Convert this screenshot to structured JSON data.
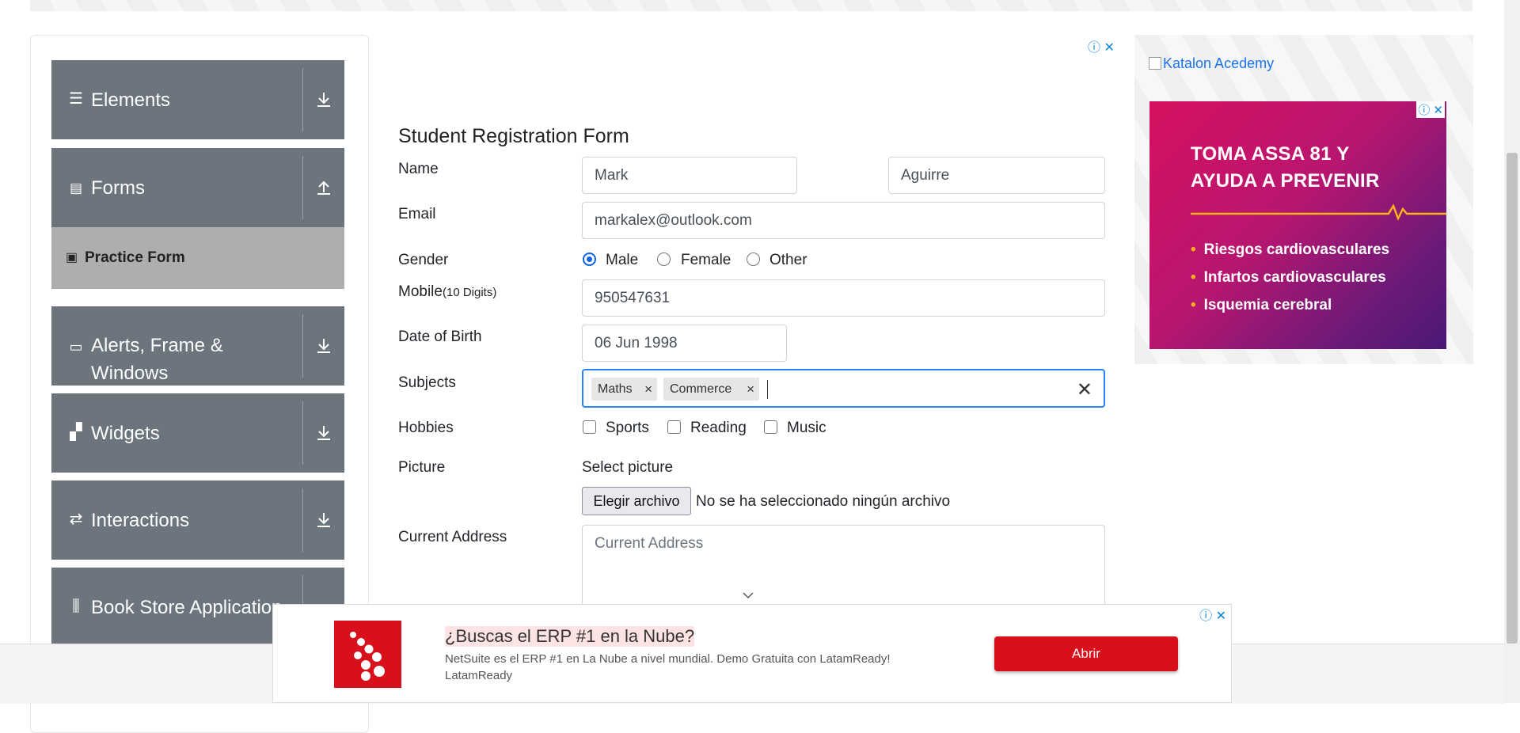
{
  "sidebar": {
    "groups": [
      {
        "label": "Elements",
        "icon": "hamburger-icon"
      },
      {
        "label": "Forms",
        "icon": "document-icon"
      },
      {
        "label": "Alerts, Frame &",
        "label2": "Windows",
        "icon": "window-icon"
      },
      {
        "label": "Widgets",
        "icon": "widgets-icon"
      },
      {
        "label": "Interactions",
        "icon": "interactions-icon"
      },
      {
        "label": "Book Store Application",
        "icon": "books-icon"
      }
    ],
    "active_item": "Practice Form"
  },
  "form": {
    "title": "Student Registration Form",
    "name_label": "Name",
    "first_name": "Mark",
    "last_name": "Aguirre",
    "email_label": "Email",
    "email": "markalex@outlook.com",
    "gender_label": "Gender",
    "gender_options": [
      "Male",
      "Female",
      "Other"
    ],
    "gender_selected": "Male",
    "mobile_label": "Mobile",
    "mobile_hint": "(10 Digits)",
    "mobile": "950547631",
    "dob_label": "Date of Birth",
    "dob": "06 Jun 1998",
    "subjects_label": "Subjects",
    "subjects": [
      "Maths",
      "Commerce"
    ],
    "hobbies_label": "Hobbies",
    "hobbies": [
      "Sports",
      "Reading",
      "Music"
    ],
    "picture_label": "Picture",
    "select_picture": "Select picture",
    "file_button": "Elegir archivo",
    "file_status": "No se ha seleccionado ningún archivo",
    "address_label": "Current Address",
    "address_placeholder": "Current Address"
  },
  "right_ad": {
    "image_alt": "Katalon Acedemy",
    "headline_1": "TOMA ASSA 81 Y",
    "headline_2": "AYUDA A PREVENIR",
    "items": [
      "Riesgos cardiovasculares",
      "Infartos cardiovasculares",
      "Isquemia cerebral"
    ]
  },
  "bottom_ad": {
    "title": "¿Buscas el ERP #1 en la Nube?",
    "description": "NetSuite es el ERP #1 en La Nube a nivel mundial. Demo Gratuita con LatamReady!",
    "advertiser": "LatamReady",
    "cta": "Abrir"
  },
  "colors": {
    "sidebar_group": "#6c757d",
    "active_item": "#aeaeae",
    "focus": "#2684ff",
    "ad_red": "#d8101c"
  }
}
